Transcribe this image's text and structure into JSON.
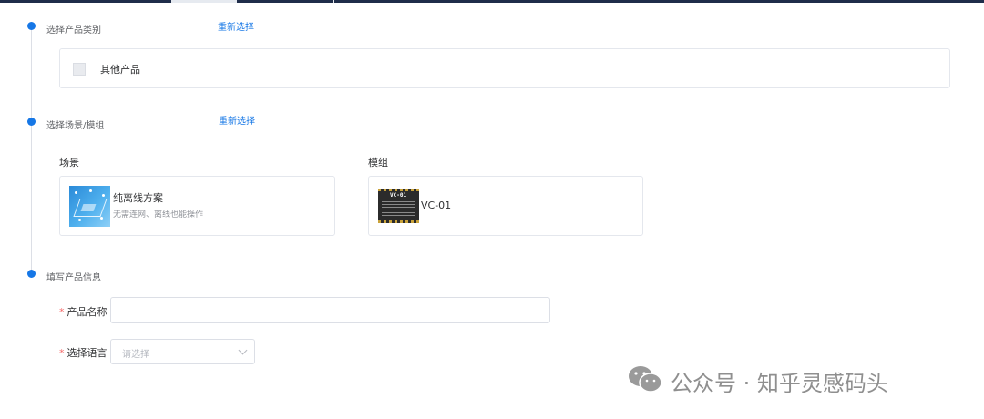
{
  "steps": [
    {
      "title": "选择产品类别",
      "action": "重新选择"
    },
    {
      "title": "选择场景/模组",
      "action": "重新选择"
    },
    {
      "title": "填写产品信息"
    }
  ],
  "category": {
    "label": "其他产品"
  },
  "scene_section": {
    "label": "场景",
    "card": {
      "title": "纯离线方案",
      "description": "无需连网、离线也能操作"
    }
  },
  "module_section": {
    "label": "模组",
    "card": {
      "name": "VC-01",
      "chip_text": "VC-01"
    }
  },
  "form": {
    "product_name": {
      "label": "产品名称",
      "required": true,
      "value": ""
    },
    "language": {
      "label": "选择语言",
      "required": true,
      "placeholder": "请选择"
    }
  },
  "watermark": {
    "text": "公众号 · 知乎灵感码头",
    "icon": "wechat-icon"
  },
  "colors": {
    "accent": "#1677e6",
    "required": "#f56c6c",
    "topbar": "#1f2d4a"
  }
}
